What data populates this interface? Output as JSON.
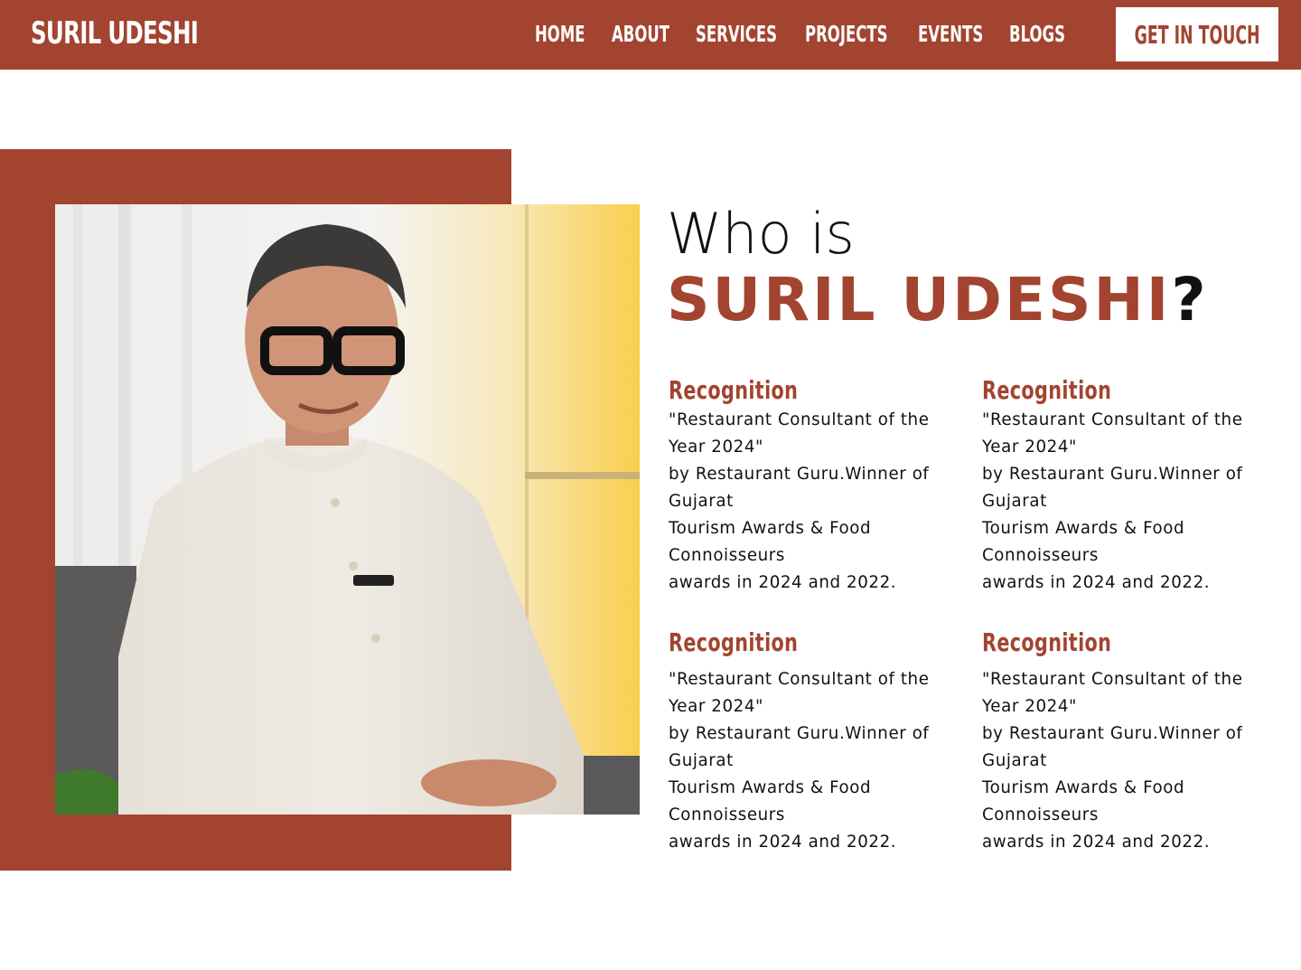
{
  "header": {
    "brand": "SURIL UDESHI",
    "nav": [
      "HOME",
      "ABOUT",
      "SERVICES",
      "PROJECTS",
      "EVENTS",
      "BLOGS"
    ],
    "cta_label": "GET IN TOUCH"
  },
  "hero": {
    "who_is": "Who is",
    "name": "SURIL UDESHI",
    "question_mark": "?",
    "photo_alt": "Portrait of Suril Udeshi"
  },
  "cards": [
    {
      "title": "Recognition",
      "lines": [
        "\"Restaurant Consultant of the",
        "Year 2024\"",
        "by Restaurant Guru.Winner of",
        "Gujarat",
        "Tourism Awards & Food",
        "Connoisseurs",
        "awards in 2024 and 2022."
      ]
    },
    {
      "title": "Recognition",
      "lines": [
        "\"Restaurant Consultant of the",
        "Year 2024\"",
        "by Restaurant Guru.Winner of",
        "Gujarat",
        "Tourism Awards & Food",
        "Connoisseurs",
        "awards in 2024 and 2022."
      ]
    },
    {
      "title": "Recognition",
      "lines": [
        "\"Restaurant Consultant of the",
        "Year 2024\"",
        "by Restaurant Guru.Winner of",
        "Gujarat",
        "Tourism Awards & Food",
        "Connoisseurs",
        "awards in 2024 and 2022."
      ]
    },
    {
      "title": "Recognition",
      "lines": [
        "\"Restaurant Consultant of the",
        "Year 2024\"",
        "by Restaurant Guru.Winner of",
        "Gujarat",
        "Tourism Awards & Food",
        "Connoisseurs",
        "awards in 2024 and 2022."
      ]
    }
  ],
  "colors": {
    "brand": "#a24430",
    "text": "#111111",
    "background": "#ffffff"
  }
}
